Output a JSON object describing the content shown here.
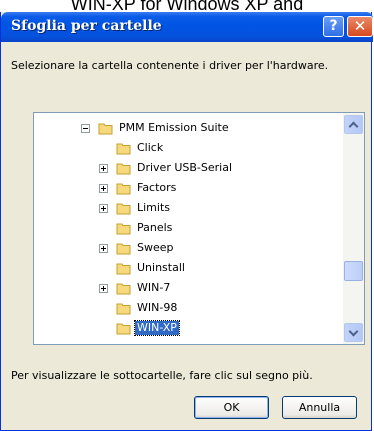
{
  "background_caption": "WIN-XP for Windows XP and",
  "dialog": {
    "title": "Sfoglia per cartelle",
    "help_glyph": "?",
    "close_glyph": "✕",
    "instruction": "Selezionare la cartella contenente i driver per l'hardware.",
    "hint": "Per visualizzare le sottocartelle, fare clic sul segno più.",
    "ok_label": "OK",
    "cancel_label": "Annulla"
  },
  "tree": {
    "items": [
      {
        "label": "PMM Emission Suite",
        "expander": "minus",
        "selected": false
      },
      {
        "label": "Click",
        "expander": "none",
        "selected": false
      },
      {
        "label": "Driver USB-Serial",
        "expander": "plus",
        "selected": false
      },
      {
        "label": "Factors",
        "expander": "plus",
        "selected": false
      },
      {
        "label": "Limits",
        "expander": "plus",
        "selected": false
      },
      {
        "label": "Panels",
        "expander": "none",
        "selected": false
      },
      {
        "label": "Sweep",
        "expander": "plus",
        "selected": false
      },
      {
        "label": "Uninstall",
        "expander": "none",
        "selected": false
      },
      {
        "label": "WIN-7",
        "expander": "plus",
        "selected": false
      },
      {
        "label": "WIN-98",
        "expander": "none",
        "selected": false
      },
      {
        "label": "WIN-XP",
        "expander": "none",
        "selected": true
      }
    ]
  },
  "colors": {
    "titlebar": "#0054e3",
    "selection": "#316ac5",
    "folder": "#f5d97c"
  }
}
